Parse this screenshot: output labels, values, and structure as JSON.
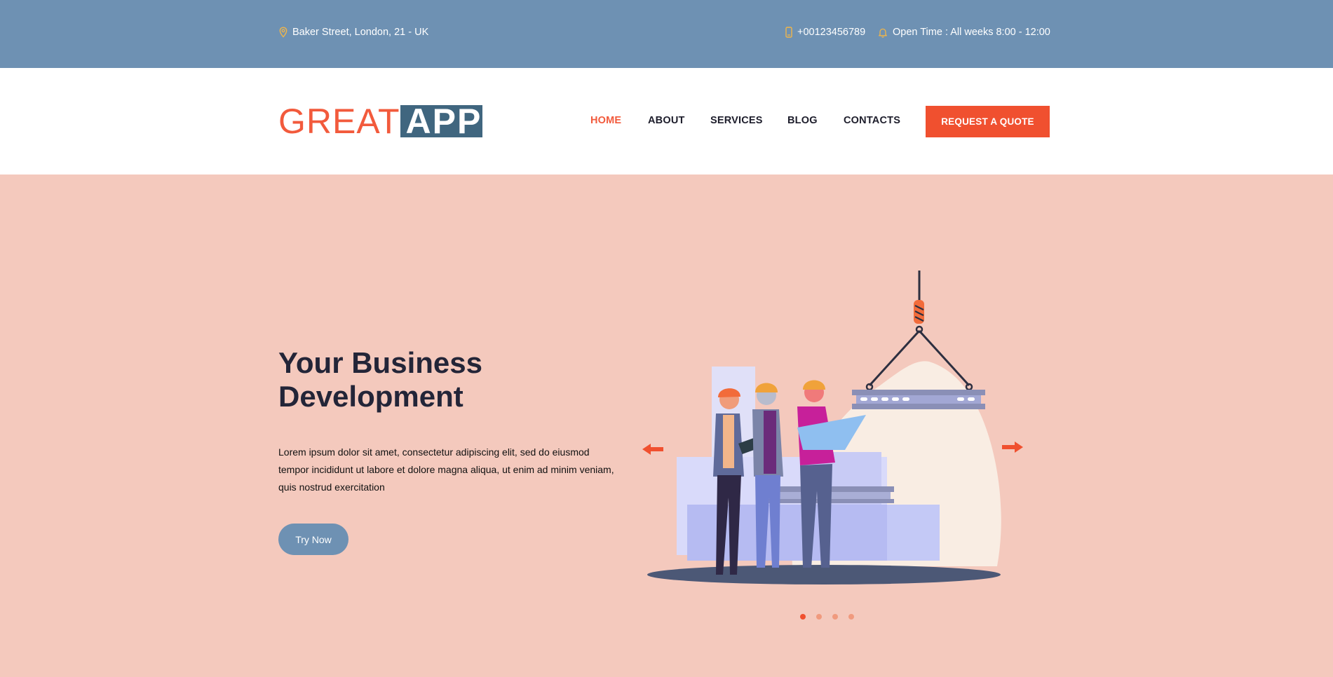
{
  "topbar": {
    "address": "Baker Street, London, 21 - UK",
    "phone": "+00123456789",
    "hours": "Open Time : All weeks 8:00 - 12:00",
    "icon_color": "#f0b54a"
  },
  "header": {
    "logo": {
      "part1": "GREAT",
      "part2": "APP"
    },
    "nav": [
      {
        "label": "HOME",
        "active": true
      },
      {
        "label": "ABOUT"
      },
      {
        "label": "SERVICES"
      },
      {
        "label": "BLOG"
      },
      {
        "label": "CONTACTS"
      }
    ],
    "cta_label": "REQUEST A QUOTE"
  },
  "hero": {
    "title": "Your Business Development",
    "text": "Lorem ipsum dolor sit amet, consectetur adipiscing elit, sed do eiusmod tempor incididunt ut labore et dolore magna aliqua, ut enim ad minim veniam, quis nostrud exercitation",
    "button_label": "Try Now",
    "slides_total": 4,
    "active_slide": 1
  },
  "colors": {
    "topbar_bg": "#6e91b3",
    "accent": "#f0502f",
    "hero_bg": "#f4c9bd",
    "heading": "#232538",
    "logo_box": "#40667f"
  }
}
